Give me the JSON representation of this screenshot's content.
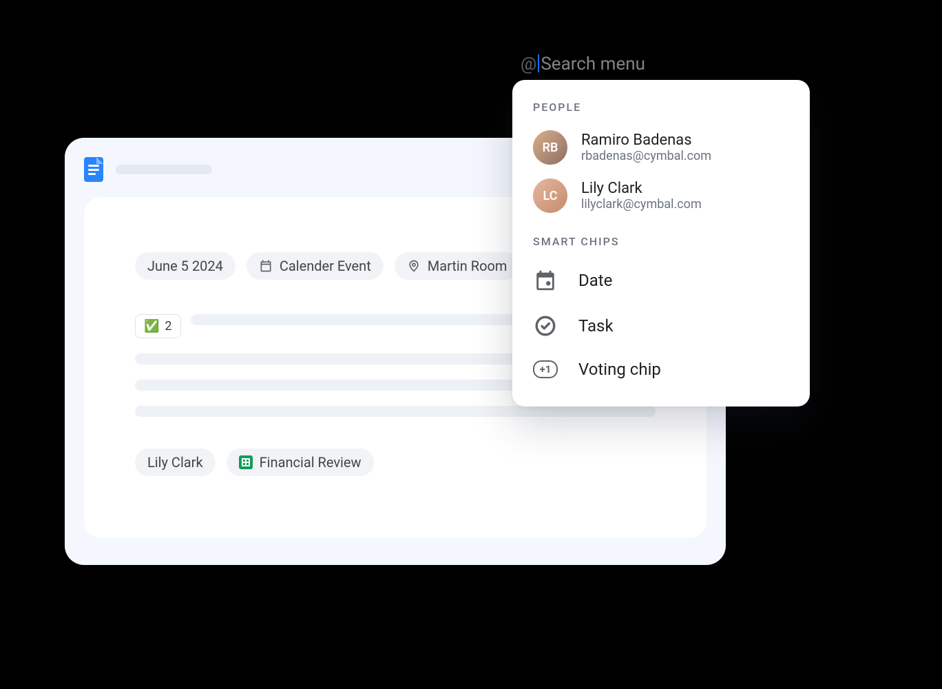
{
  "doc": {
    "chips_row1": {
      "date": "June 5 2024",
      "event": "Calender Event",
      "room": "Martin Room"
    },
    "vote_count": "2",
    "chips_row2": {
      "person": "Lily Clark",
      "sheet": "Financial Review"
    }
  },
  "search": {
    "at_symbol": "@",
    "placeholder": "Search menu"
  },
  "menu": {
    "sections": {
      "people_label": "PEOPLE",
      "smart_label": "SMART CHIPS"
    },
    "people": [
      {
        "name": "Ramiro Badenas",
        "email": "rbadenas@cymbal.com",
        "initials": "RB"
      },
      {
        "name": "Lily Clark",
        "email": "lilyclark@cymbal.com",
        "initials": "LC"
      }
    ],
    "smart_chips": {
      "date": "Date",
      "task": "Task",
      "voting": "Voting chip",
      "plus1": "+1"
    }
  }
}
